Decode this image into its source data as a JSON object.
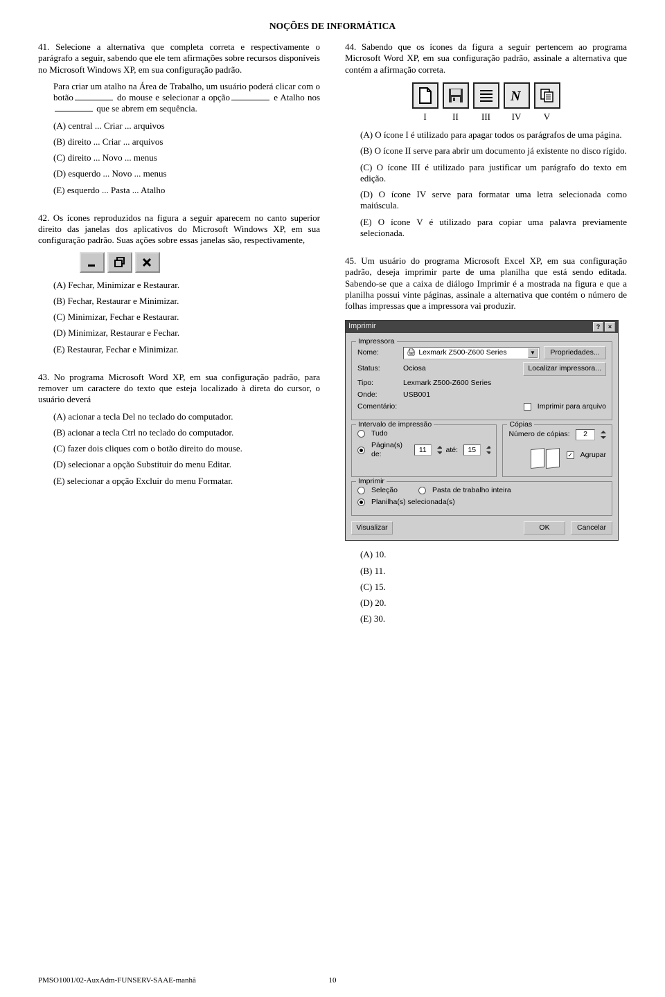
{
  "section_title": "NOÇÕES DE INFORMÁTICA",
  "q41": {
    "num": "41.",
    "text": "Selecione a alternativa que completa correta e respectivamente o parágrafo a seguir, sabendo que ele tem afirmações sobre recursos disponíveis no Microsoft Windows XP, em sua configuração padrão.",
    "para_1": "Para criar um atalho na Área de Trabalho, um usuário poderá clicar com o botão",
    "para_2": "do mouse e selecionar a opção",
    "para_3": "e Atalho nos",
    "para_4": "que se abrem em sequência.",
    "a": "(A) central ... Criar ... arquivos",
    "b": "(B) direito ... Criar ... arquivos",
    "c": "(C) direito ... Novo ... menus",
    "d": "(D) esquerdo ... Novo ... menus",
    "e": "(E) esquerdo ... Pasta ... Atalho"
  },
  "q42": {
    "num": "42.",
    "text": "Os ícones reproduzidos na figura a seguir aparecem no canto superior direito das janelas dos aplicativos do Microsoft Windows XP, em sua configuração padrão. Suas ações sobre essas janelas são, respectivamente,",
    "a": "(A) Fechar, Minimizar e Restaurar.",
    "b": "(B) Fechar, Restaurar e Minimizar.",
    "c": "(C) Minimizar, Fechar e Restaurar.",
    "d": "(D) Minimizar, Restaurar e Fechar.",
    "e": "(E) Restaurar, Fechar e Minimizar."
  },
  "q43": {
    "num": "43.",
    "text": "No programa Microsoft Word XP, em sua configuração padrão, para remover um caractere do texto que esteja localizado à direta do cursor, o usuário deverá",
    "a": "(A) acionar a tecla Del no teclado do computador.",
    "b": "(B) acionar a tecla Ctrl no teclado do computador.",
    "c": "(C) fazer dois cliques com o botão direito do mouse.",
    "d": "(D) selecionar a opção Substituir do menu Editar.",
    "e": "(E) selecionar a opção Excluir do menu Formatar."
  },
  "q44": {
    "num": "44.",
    "text": "Sabendo que os ícones da figura a seguir pertencem ao programa Microsoft Word XP, em sua configuração padrão, assinale a alternativa que contém a afirmação correta.",
    "labels": [
      "I",
      "II",
      "III",
      "IV",
      "V"
    ],
    "a": "(A) O ícone I é utilizado para apagar todos os parágrafos de uma página.",
    "b": "(B) O ícone II serve para abrir um documento já existente no disco rígido.",
    "c": "(C) O ícone III é utilizado para justificar um parágrafo do texto em edição.",
    "d": "(D) O ícone IV serve para formatar uma letra selecionada como maiúscula.",
    "e": "(E) O ícone V é utilizado para copiar uma palavra previamente selecionada."
  },
  "q45": {
    "num": "45.",
    "text": "Um usuário do programa Microsoft Excel XP, em sua configuração padrão, deseja imprimir parte de uma planilha que está sendo editada. Sabendo-se que a caixa de diálogo Imprimir é a mostrada na figura e que a planilha possui vinte páginas, assinale a alternativa que contém o número de folhas impressas que a impressora vai produzir.",
    "a": "(A) 10.",
    "b": "(B) 11.",
    "c": "(C) 15.",
    "d": "(D) 20.",
    "e": "(E) 30."
  },
  "print_dialog": {
    "title": "Imprimir",
    "grp_printer": "Impressora",
    "lbl_nome": "Nome:",
    "printer_name": "Lexmark Z500-Z600 Series",
    "lbl_status": "Status:",
    "status_val": "Ociosa",
    "lbl_tipo": "Tipo:",
    "tipo_val": "Lexmark Z500-Z600 Series",
    "lbl_onde": "Onde:",
    "onde_val": "USB001",
    "lbl_coment": "Comentário:",
    "btn_props": "Propriedades...",
    "btn_find": "Localizar impressora...",
    "chk_file": "Imprimir para arquivo",
    "grp_range": "Intervalo de impressão",
    "rad_tudo": "Tudo",
    "rad_pags": "Página(s) de:",
    "lbl_ate": "até:",
    "val_de": "11",
    "val_ate": "15",
    "grp_copies": "Cópias",
    "lbl_ncop": "Número de cópias:",
    "ncop_val": "2",
    "chk_agrupar": "Agrupar",
    "grp_print": "Imprimir",
    "rad_sel": "Seleção",
    "rad_pasta": "Pasta de trabalho inteira",
    "rad_plan": "Planilha(s) selecionada(s)",
    "btn_preview": "Visualizar",
    "btn_ok": "OK",
    "btn_cancel": "Cancelar"
  },
  "footer_left": "PMSO1001/02-AuxAdm-FUNSERV-SAAE-manhã",
  "footer_page": "10"
}
